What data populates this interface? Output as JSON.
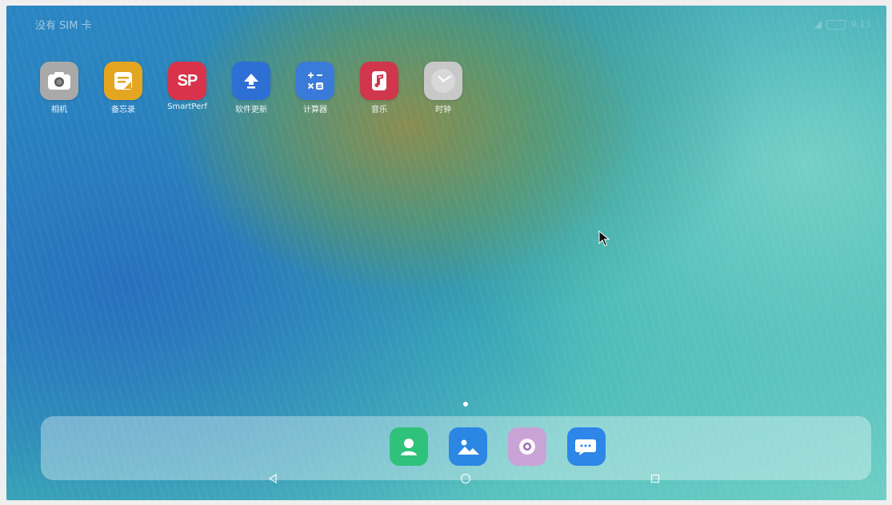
{
  "status": {
    "carrier": "没有 SIM 卡",
    "time": "9:13"
  },
  "apps": [
    {
      "name": "camera-app",
      "label": "相机",
      "icon": "camera-icon",
      "color": "#a9a9a9"
    },
    {
      "name": "memo-app",
      "label": "备忘录",
      "icon": "notepad-icon",
      "color": "#e4a520"
    },
    {
      "name": "smartperf-app",
      "label": "SmartPerf",
      "icon": "sp-logo-icon",
      "icon_text": "SP",
      "color": "#d8334a"
    },
    {
      "name": "software-update-app",
      "label": "软件更新",
      "icon": "upload-arrow-icon",
      "color": "#2e6fd6"
    },
    {
      "name": "calculator-app",
      "label": "计算器",
      "icon": "calculator-icon",
      "color": "#3a7bd9"
    },
    {
      "name": "music-app",
      "label": "音乐",
      "icon": "music-note-icon",
      "color": "#d0374c"
    },
    {
      "name": "clock-app",
      "label": "时钟",
      "icon": "clock-icon",
      "color": "#c8c8c8"
    }
  ],
  "dock": [
    {
      "name": "contacts-app",
      "icon": "person-icon",
      "color": "#2fc27a"
    },
    {
      "name": "gallery-app",
      "icon": "image-icon",
      "color": "#2b86e4"
    },
    {
      "name": "browser-app",
      "icon": "browser-icon",
      "color": "#c9a3d6"
    },
    {
      "name": "messages-app",
      "icon": "chat-bubble-icon",
      "color": "#2d86e8"
    }
  ],
  "navigation": {
    "back": "back-triangle-icon",
    "home": "home-circle-icon",
    "recents": "recents-square-icon"
  }
}
